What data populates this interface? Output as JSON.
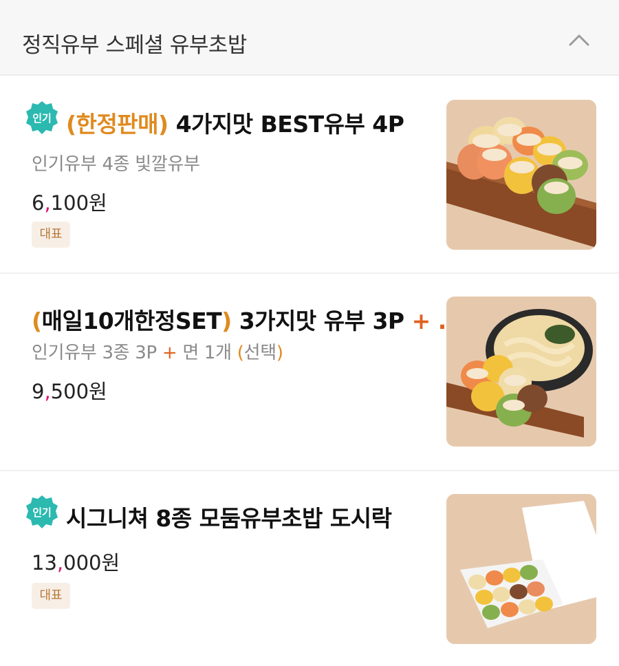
{
  "header": {
    "title": "정직유부 스페셜 유부초밥"
  },
  "badges": {
    "popular": "인기",
    "representative": "대표"
  },
  "items": [
    {
      "name_prefix": "(한정판매)",
      "name_main": " 4가지맛 BEST유부 4P",
      "description": "인기유부 4종 빛깔유부",
      "price_head": "6",
      "price_comma": ",",
      "price_tail": "100원"
    },
    {
      "name_paren_open": "(",
      "name_paren_inner": "매일10개한정SET",
      "name_paren_close": ")",
      "name_main": " 3가지맛 유부 3P ",
      "name_plus": "+",
      "name_ellipsis": " ...",
      "desc_a": "인기유부 3종 3P ",
      "desc_plus": "+",
      "desc_b": " 면 1개 ",
      "desc_paren_open": "(",
      "desc_paren_inner": "선택",
      "desc_paren_close": ")",
      "price_head": "9",
      "price_comma": ",",
      "price_tail": "500원"
    },
    {
      "name_main": "시그니쳐 8종 모둠유부초밥 도시락",
      "price_head": "13",
      "price_comma": ",",
      "price_tail": "000원"
    }
  ],
  "colors": {
    "accent_orange": "#e08a1e",
    "badge_teal": "#2bb9b0",
    "price_comma": "#e0106a",
    "tag_bg": "#f7efe6",
    "tag_text": "#b8783a"
  },
  "icons": {
    "collapse": "chevron-up-icon",
    "popular_badge": "popular-badge-icon"
  }
}
